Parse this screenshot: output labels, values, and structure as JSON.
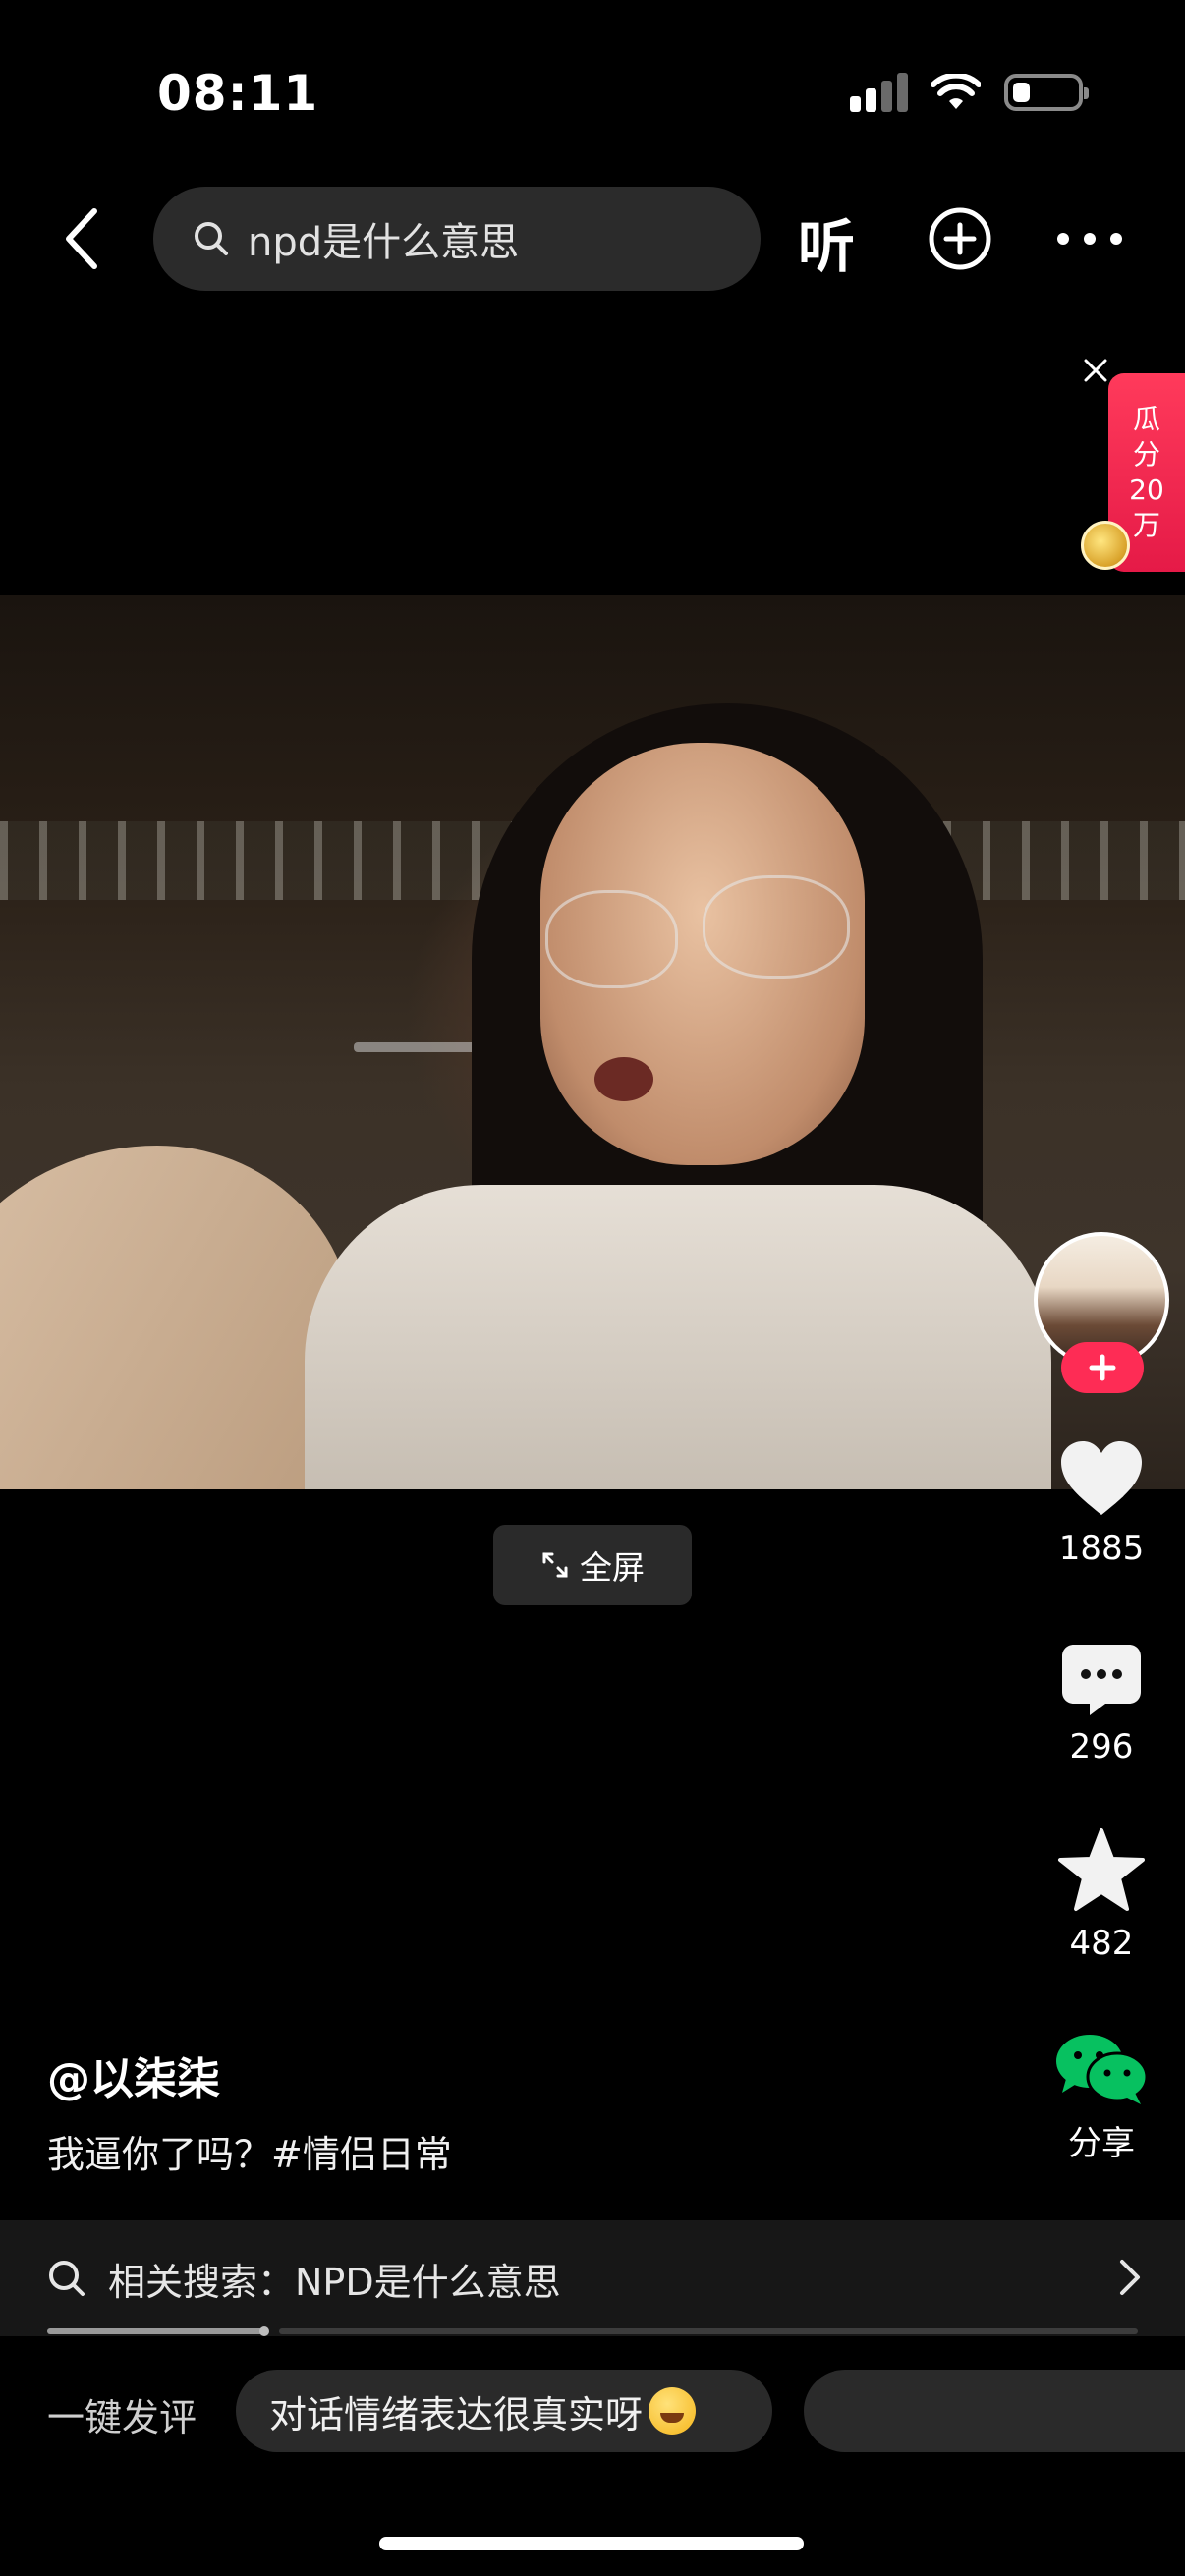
{
  "status_bar": {
    "time": "08:11"
  },
  "header": {
    "search_query": "npd是什么意思",
    "listen_label": "听"
  },
  "promo": {
    "lines": [
      "瓜",
      "分",
      "20",
      "万"
    ]
  },
  "video": {
    "fullscreen_label": "全屏"
  },
  "sidebar": {
    "likes": "1885",
    "comments": "296",
    "favorites": "482",
    "share_label": "分享"
  },
  "caption": {
    "author": "@以柒柒",
    "description": "我逼你了吗？#情侣日常"
  },
  "related_search": {
    "text": "相关搜索：NPD是什么意思"
  },
  "quick_comment": {
    "label": "一键发评",
    "chips": [
      "对话情绪表达很真实呀"
    ]
  },
  "colors": {
    "accent": "#fe2c55",
    "wechat": "#07c160",
    "background": "#000000"
  }
}
